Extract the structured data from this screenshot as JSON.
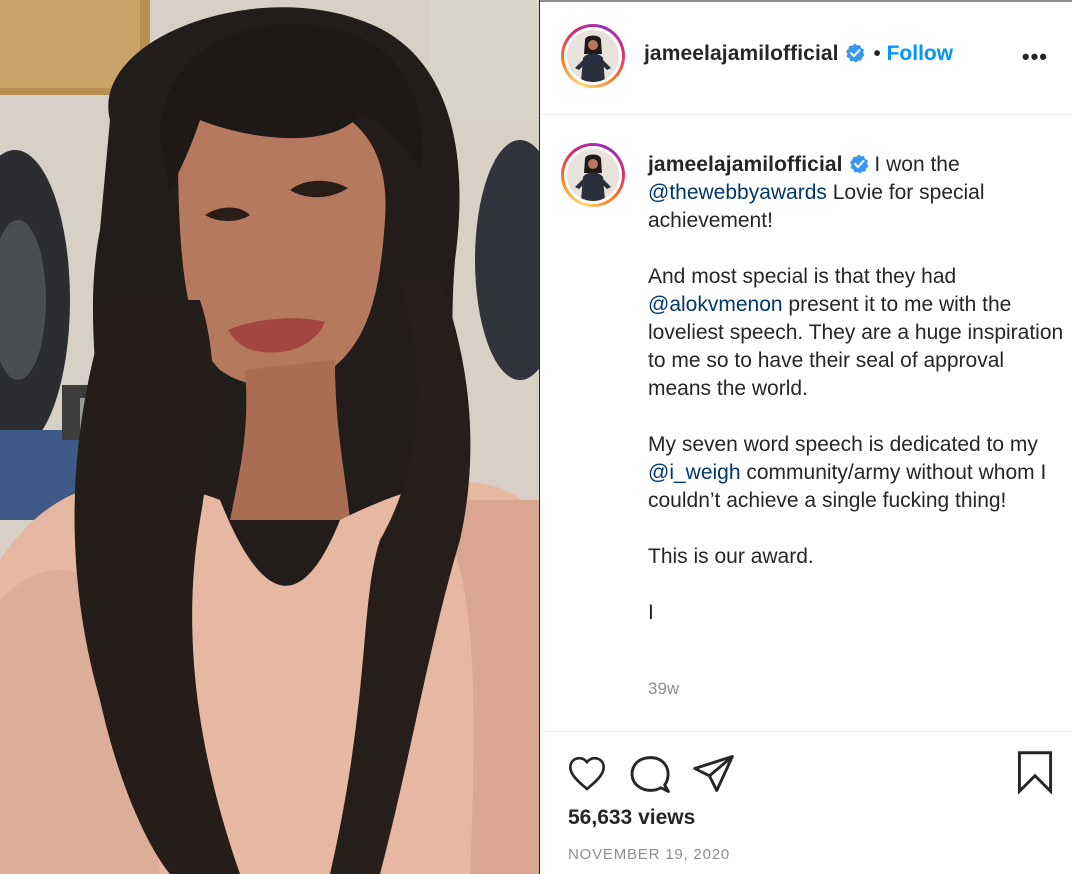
{
  "header": {
    "username": "jameelajamilofficial",
    "separator": "•",
    "follow_label": "Follow",
    "more_label": "•••",
    "icons": {
      "verified": "verified-badge-icon",
      "more": "more-options-icon"
    }
  },
  "caption": {
    "username": "jameelajamilofficial",
    "p1_text_before": " I won the ",
    "p1_mention": "@thewebbyawards",
    "p1_text_after": " Lovie for special achievement!",
    "p2_text_before": "And most special is that they had ",
    "p2_mention": "@alokvmenon",
    "p2_text_after": " present it to me with the loveliest speech. They are a huge inspiration to me so to have their seal of approval means the world.",
    "p3_text_before": "My seven word speech is dedicated to my ",
    "p3_mention": "@i_weigh",
    "p3_text_after": " community/army without whom I couldn’t achieve a single fucking thing!",
    "p4": "This is our award.",
    "p5": "I",
    "time_ago": "39w"
  },
  "actions": {
    "icons": [
      "heart-icon",
      "comment-icon",
      "share-icon",
      "bookmark-icon"
    ],
    "views": "56,633 views",
    "date": "NOVEMBER 19, 2020"
  },
  "colors": {
    "link_blue": "#0095f6",
    "mention_blue": "#00376b",
    "verified_blue": "#3897f0",
    "muted_gray": "#8e8e8e"
  }
}
